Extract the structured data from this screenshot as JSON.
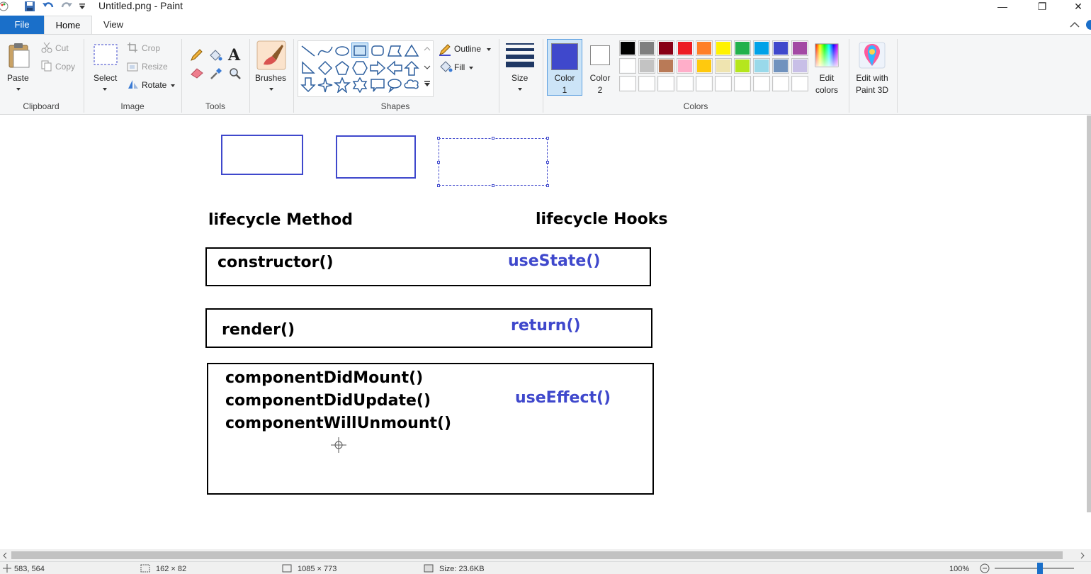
{
  "window": {
    "title": "Untitled.png - Paint",
    "minimize": "—",
    "restore": "❐",
    "close": "✕"
  },
  "tabs": [
    {
      "label": "File"
    },
    {
      "label": "Home"
    },
    {
      "label": "View"
    }
  ],
  "ribbon": {
    "clipboard": {
      "group_label": "Clipboard",
      "paste": "Paste",
      "cut": "Cut",
      "copy": "Copy"
    },
    "image": {
      "group_label": "Image",
      "select": "Select",
      "crop": "Crop",
      "resize": "Resize",
      "rotate": "Rotate"
    },
    "tools": {
      "group_label": "Tools"
    },
    "brushes": {
      "label": "Brushes"
    },
    "shapes": {
      "group_label": "Shapes",
      "outline": "Outline",
      "fill": "Fill"
    },
    "size": {
      "label": "Size"
    },
    "colors": {
      "group_label": "Colors",
      "color1_label": "Color",
      "color1_num": "1",
      "color2_label": "Color",
      "color2_num": "2",
      "color1_value": "#3f48cc",
      "color2_value": "#ffffff",
      "edit_colors_line1": "Edit",
      "edit_colors_line2": "colors",
      "palette_row1": [
        "#000000",
        "#7f7f7f",
        "#880015",
        "#ed1c24",
        "#ff7f27",
        "#fff200",
        "#22b14c",
        "#00a2e8",
        "#3f48cc",
        "#a349a4"
      ],
      "palette_row2": [
        "#ffffff",
        "#c3c3c3",
        "#b97a57",
        "#ffaec9",
        "#ffc90e",
        "#efe4b0",
        "#b5e61d",
        "#99d9ea",
        "#7092be",
        "#c8bfe7"
      ],
      "palette_row3": [
        "#ffffff",
        "#ffffff",
        "#ffffff",
        "#ffffff",
        "#ffffff",
        "#ffffff",
        "#ffffff",
        "#ffffff",
        "#ffffff",
        "#ffffff"
      ]
    },
    "paint3d": {
      "line1": "Edit with",
      "line2": "Paint 3D"
    }
  },
  "canvas": {
    "headings": {
      "left": "lifecycle Method",
      "right": "lifecycle Hooks"
    },
    "row1": {
      "method": "constructor()",
      "hook": "useState()"
    },
    "row2": {
      "method": "render()",
      "hook": "return()"
    },
    "row3": {
      "methods": [
        "componentDidMount()",
        "componentDidUpdate()",
        "componentWillUnmount()"
      ],
      "hook": "useEffect()"
    }
  },
  "statusbar": {
    "cursor_pos": "583, 564",
    "selection_size": "162 × 82",
    "image_size": "1085 × 773",
    "file_size": "Size: 23.6KB",
    "zoom": "100%"
  }
}
